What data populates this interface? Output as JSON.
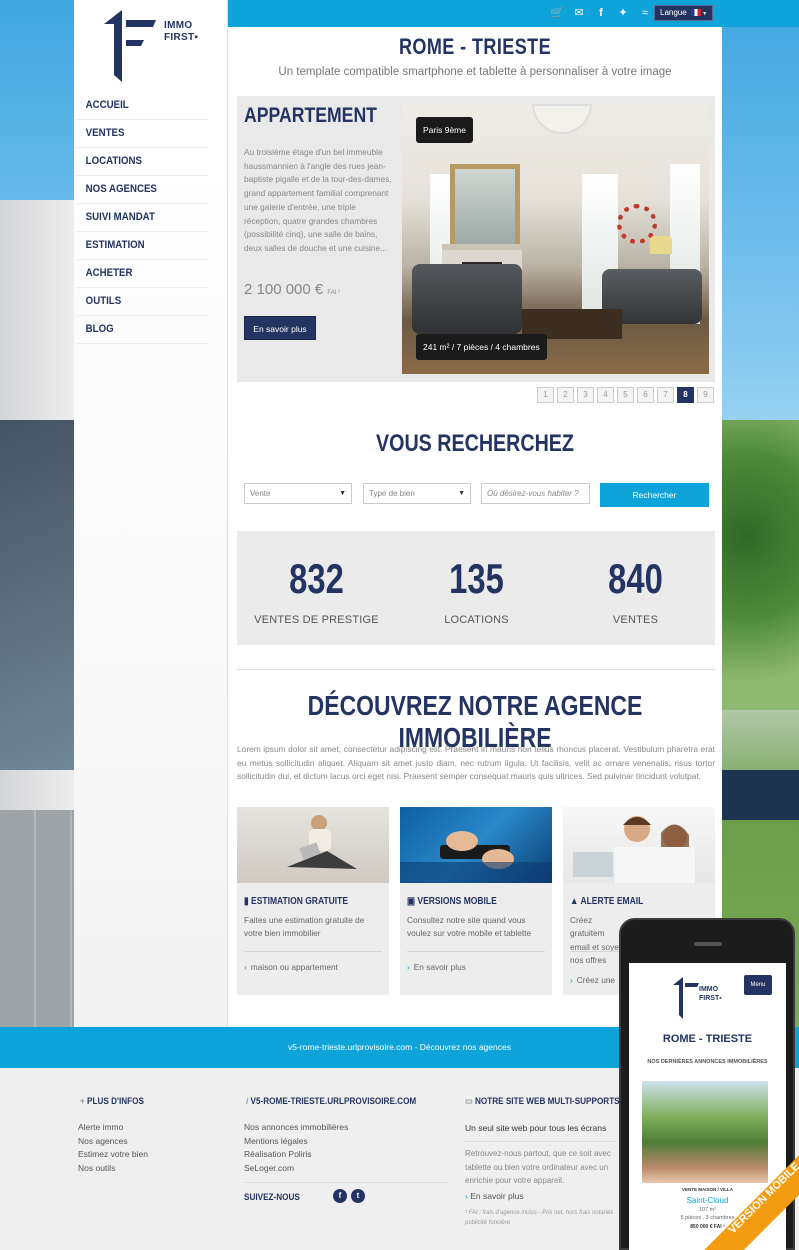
{
  "header": {
    "langue_label": "Langue",
    "icons": [
      "cart-icon",
      "mail-icon",
      "facebook-icon",
      "twitter-icon",
      "rss-icon"
    ]
  },
  "logo": {
    "line1": "IMMO",
    "line2": "FIRST▪"
  },
  "nav": [
    "ACCUEIL",
    "VENTES",
    "LOCATIONS",
    "NOS AGENCES",
    "SUIVI MANDAT",
    "ESTIMATION",
    "ACHETER",
    "OUTILS",
    "BLOG"
  ],
  "site": {
    "title": "ROME - TRIESTE",
    "subtitle": "Un template compatible smartphone et tablette à personnaliser à votre image"
  },
  "slider": {
    "type": "APPARTEMENT",
    "description": "Au troisième étage d'un bel immeuble haussmannien à l'angle des rues jean-baptiste pigalle et de la tour-des-dames, grand appartement familial comprenant une galerie d'entrée, une triple réception, quatre grandes chambres (possibilité cinq), une salle de bains, deux salles de douche et une cuisine...",
    "price": "2 100 000 €",
    "price_suffix": "FAI ¹",
    "button": "En savoir plus",
    "location_tag": "Paris 9ème",
    "details_tag": "241 m² / 7 pièces / 4 chambres",
    "pages": [
      "1",
      "2",
      "3",
      "4",
      "5",
      "6",
      "7",
      "8",
      "9"
    ],
    "active_page": "8"
  },
  "search": {
    "title": "VOUS RECHERCHEZ",
    "select1": "Vente",
    "select2": "Type de bien",
    "placeholder": "Où désirez-vous habiter ?",
    "button": "Rechercher"
  },
  "stats": [
    {
      "n": "832",
      "l": "VENTES DE PRESTIGE"
    },
    {
      "n": "135",
      "l": "LOCATIONS"
    },
    {
      "n": "840",
      "l": "VENTES"
    }
  ],
  "agency": {
    "title": "DÉCOUVREZ NOTRE AGENCE IMMOBILIÈRE",
    "text": "Lorem ipsum dolor sit amet, consectetur adipiscing elit. Praesent in mauris non tellus rhoncus placerat. Vestibulum pharetra erat eu metus sollicitudin aliquet. Aliquam sit amet justo diam, nec rutrum ligula. Ut facilisis, velit ac ornare venenatis, risus tortor sollicitudin dui, et dictum lacus orci eget nisi. Praesent semper consequat mauris quis ultrices. Sed pulvinar tincidunt volutpat."
  },
  "cards": [
    {
      "title": "ESTIMATION GRATUITE",
      "text": "Faites une estimation gratuite de votre bien immobilier",
      "link": "maison ou appartement"
    },
    {
      "title": "VERSIONS MOBILE",
      "text": "Consultez notre site quand vous voulez sur votre mobile et tablette",
      "link": "En savoir plus"
    },
    {
      "title": "ALERTE EMAIL",
      "text": "Créez gratuitem email et soyez nos offres",
      "link": "Créez une"
    }
  ],
  "bluebar": "v5-rome-trieste.urlprovisoire.com - Découvrez nos agences",
  "footer": {
    "col1": {
      "title": "PLUS D'INFOS",
      "links": [
        "Alerte immo",
        "Nos agences",
        "Estimez votre bien",
        "Nos outils"
      ]
    },
    "col2": {
      "title": "V5-ROME-TRIESTE.URLPROVISOIRE.COM",
      "links": [
        "Nos annonces immobilières",
        "Mentions légales",
        "Réalisation Poliris",
        "SeLoger.com"
      ],
      "follow": "SUIVEZ-NOUS"
    },
    "col3": {
      "title": "NOTRE SITE WEB MULTI-SUPPORTS",
      "subtitle": "Un seul site web pour tous les écrans",
      "text": "Retrouvez-nous partout, que ce soit avec tablette ou bien votre ordinateur avec un enrichie pour votre appareil.",
      "link": "En savoir plus",
      "note": "¹ FAI : frais d'agence inclus - Prix net, hors frais notariés publicité foncière"
    }
  },
  "mobile": {
    "menu": "Menu",
    "logo1": "IMMO",
    "logo2": "FIRST▪",
    "title": "ROME - TRIESTE",
    "subtitle": "NOS DERNIÈRES ANNONCES IMMOBILIÈRES",
    "type": "VENTE MAISON / VILLA",
    "city": "Saint-Cloud",
    "area": "107 m²",
    "rooms": "5 pièces , 3 chambres",
    "price": "850 000 € FAI ¹",
    "ribbon": "VERSION MOBILE"
  }
}
